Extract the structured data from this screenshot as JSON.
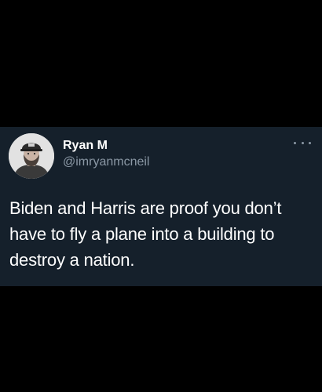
{
  "tweet": {
    "author": {
      "display_name": "Ryan M",
      "handle": "@imryanmcneil",
      "avatar_icon": "user-avatar-photo"
    },
    "more_icon": "more-dots-icon",
    "text": "Biden and Harris are proof you don’t have to fly a plane into a building to destroy a nation."
  },
  "colors": {
    "page_background": "#000000",
    "card_background": "#15202b",
    "primary_text": "#ffffff",
    "secondary_text": "#8b98a5"
  }
}
